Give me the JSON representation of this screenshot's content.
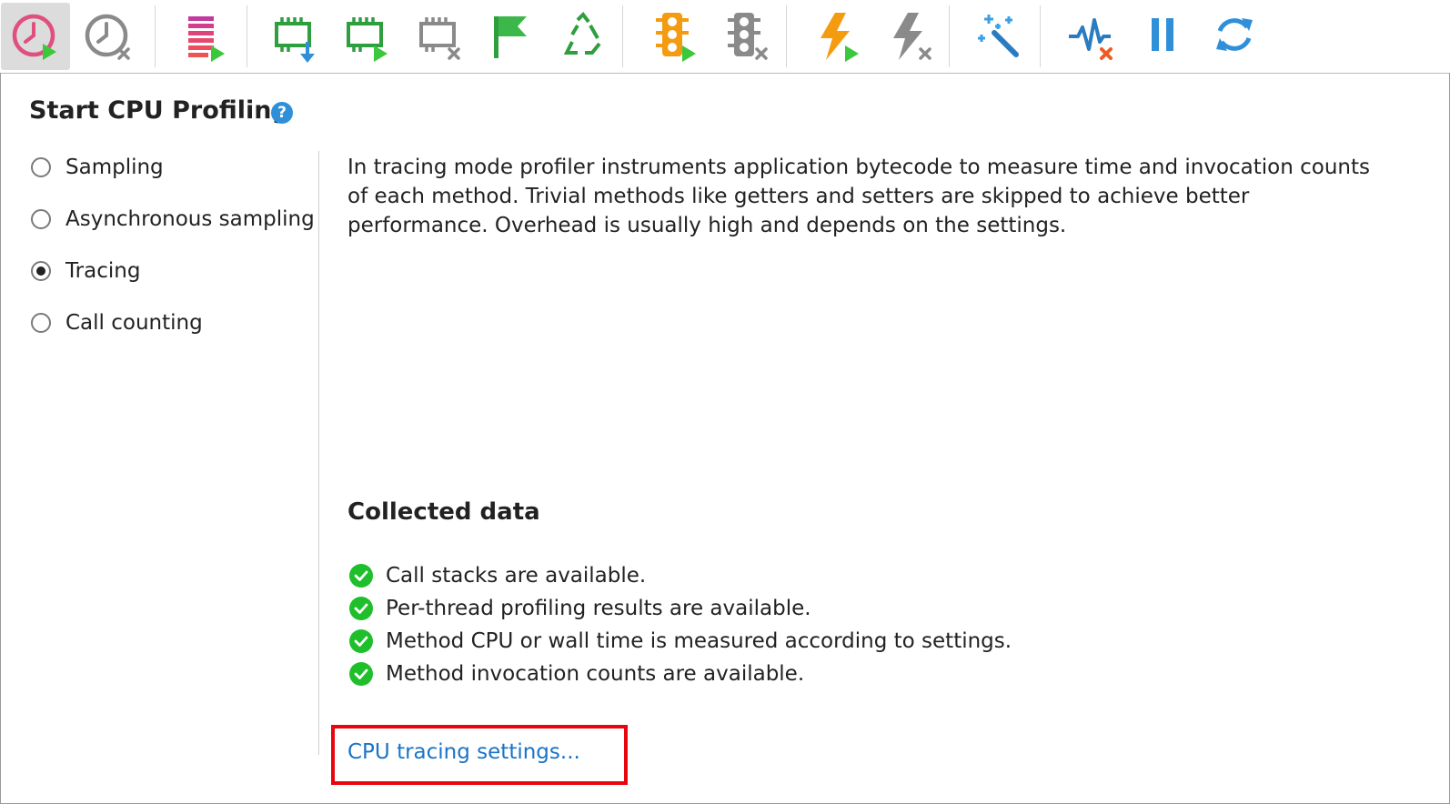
{
  "toolbar": {
    "buttons": [
      {
        "icon": "start-cpu-profiling-icon",
        "active": true
      },
      {
        "icon": "stop-cpu-profiling-icon",
        "active": false
      },
      {
        "icon": "start-allocation-recording-icon",
        "active": false
      },
      {
        "icon": "capture-memory-snapshot-icon",
        "active": false
      },
      {
        "icon": "start-memory-recording-icon",
        "active": false
      },
      {
        "icon": "stop-memory-recording-icon",
        "active": false
      },
      {
        "icon": "flag-icon",
        "active": false
      },
      {
        "icon": "force-gc-icon",
        "active": false
      },
      {
        "icon": "start-monitor-profiling-icon",
        "active": false
      },
      {
        "icon": "stop-monitor-profiling-icon",
        "active": false
      },
      {
        "icon": "start-exception-profiling-icon",
        "active": false
      },
      {
        "icon": "stop-exception-profiling-icon",
        "active": false
      },
      {
        "icon": "magic-wand-icon",
        "active": false
      },
      {
        "icon": "stop-telemetry-icon",
        "active": false
      },
      {
        "icon": "pause-icon",
        "active": false
      },
      {
        "icon": "refresh-icon",
        "active": false
      }
    ],
    "colors": {
      "green": "#2e9e3e",
      "play_green": "#3cc83c",
      "gray": "#8a8a8a",
      "orange": "#f59b12",
      "blue": "#2f8fd8",
      "red_x": "#ef5b25"
    }
  },
  "panel": {
    "title": "Start CPU Profiling",
    "help_icon": "?",
    "modes": [
      {
        "label": "Sampling",
        "checked": false
      },
      {
        "label": "Asynchronous sampling",
        "checked": false
      },
      {
        "label": "Tracing",
        "checked": true
      },
      {
        "label": "Call counting",
        "checked": false
      }
    ],
    "description": "In tracing mode profiler instruments application bytecode to measure time and invocation counts of each method. Trivial methods like getters and setters are skipped to achieve better performance. Overhead is usually high and depends on the settings.",
    "collected_title": "Collected data",
    "collected_items": [
      "Call stacks are available.",
      "Per-thread profiling results are available.",
      "Method CPU or wall time is measured according to settings.",
      "Method invocation counts are available."
    ],
    "settings_link": "CPU tracing settings...",
    "highlight_color": "#e8050d"
  }
}
